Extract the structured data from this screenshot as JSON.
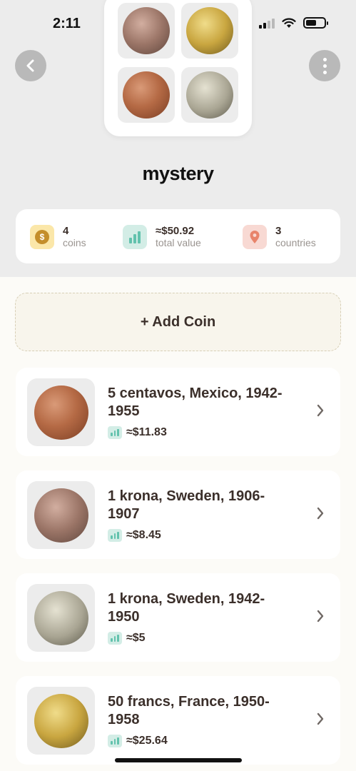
{
  "status_bar": {
    "time": "2:11"
  },
  "collection": {
    "title": "mystery",
    "stats": {
      "coins": {
        "number": "4",
        "label": "coins"
      },
      "value": {
        "number": "≈$50.92",
        "label": "total value"
      },
      "countries": {
        "number": "3",
        "label": "countries"
      }
    }
  },
  "add_coin_label": "+ Add Coin",
  "coins": [
    {
      "name": "5 centavos, Mexico, 1942-1955",
      "value": "≈$11.83"
    },
    {
      "name": "1 krona, Sweden, 1906-1907",
      "value": "≈$8.45"
    },
    {
      "name": "1 krona, Sweden, 1942-1950",
      "value": "≈$5"
    },
    {
      "name": "50 francs, France, 1950-1958",
      "value": "≈$25.64"
    }
  ],
  "icons": {
    "back": "chevron-left-icon",
    "more": "more-vertical-icon",
    "coins_stat": "dollar-coin-icon",
    "value_stat": "bar-chart-icon",
    "countries_stat": "map-pin-icon",
    "row_arrow": "chevron-right-icon"
  },
  "colors": {
    "accent_text": "#3b2f2a",
    "value_icon": "#62c2ad",
    "pin": "#e8846b",
    "coin_badge": "#c48e2b"
  }
}
